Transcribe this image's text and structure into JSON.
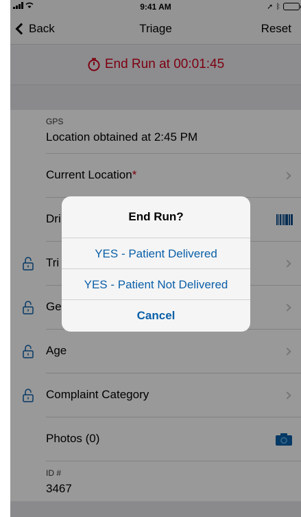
{
  "status_bar": {
    "time": "9:41 AM"
  },
  "nav": {
    "back_label": "Back",
    "title": "Triage",
    "reset_label": "Reset"
  },
  "end_run": {
    "label": "End Run at 00:01:45",
    "color": "#d0021b"
  },
  "gps": {
    "label": "GPS",
    "value": "Location obtained at 2:45 PM"
  },
  "rows": {
    "current_location": {
      "label": "Current Location",
      "required_mark": "*"
    },
    "driver": {
      "label": "Dri"
    },
    "triage": {
      "label": "Tri"
    },
    "gender": {
      "label": "Ge"
    },
    "age": {
      "label": "Age"
    },
    "complaint": {
      "label": "Complaint Category"
    },
    "photos": {
      "label": "Photos (0)"
    }
  },
  "id_field": {
    "label": "ID #",
    "value": "3467"
  },
  "dialog": {
    "title": "End Run?",
    "option_delivered": "YES - Patient Delivered",
    "option_not_delivered": "YES - Patient Not Delivered",
    "cancel": "Cancel"
  },
  "icons": {
    "lock": "unlock-icon",
    "barcode": "barcode-icon",
    "camera": "camera-icon",
    "stopwatch": "stopwatch-icon"
  },
  "colors": {
    "accent": "#0a5fa8",
    "alert_red": "#d0021b"
  }
}
